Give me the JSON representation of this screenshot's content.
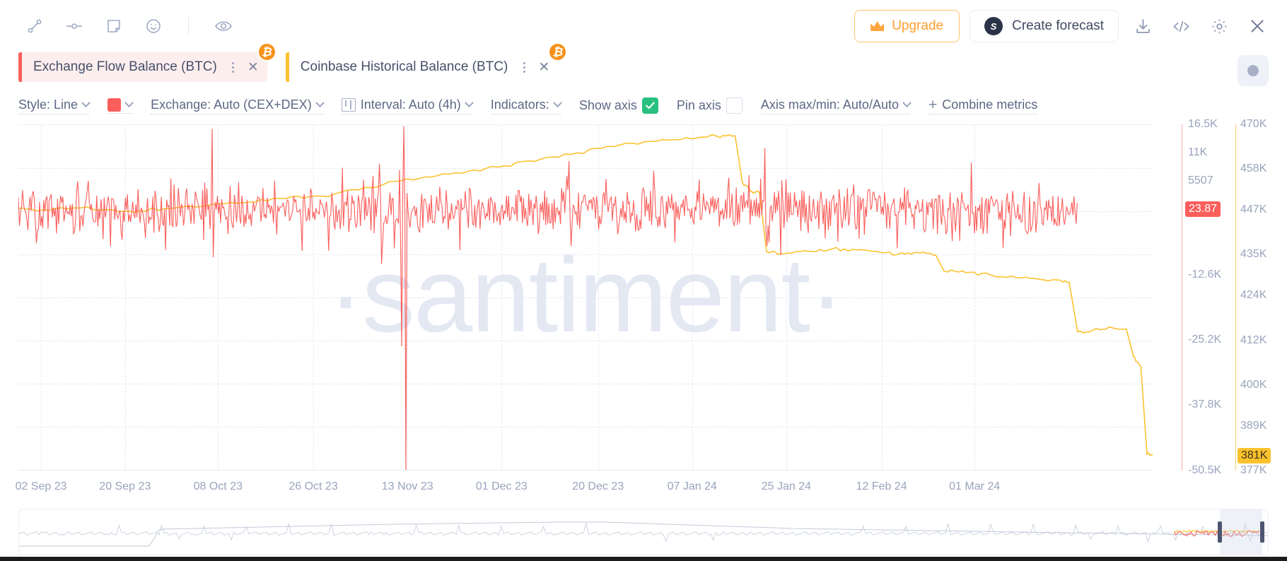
{
  "toolbar": {
    "tools": [
      {
        "name": "line-segment-icon",
        "title": "Draw line"
      },
      {
        "name": "horizontal-line-icon",
        "title": "Horizontal line"
      },
      {
        "name": "note-icon",
        "title": "Add note"
      },
      {
        "name": "emoji-icon",
        "title": "Add emoji"
      },
      {
        "name": "eye-icon",
        "title": "Toggle visibility"
      }
    ],
    "upgrade_label": "Upgrade",
    "forecast_label": "Create forecast",
    "s_logo_text": "S",
    "download_title": "Download",
    "embed_title": "Embed code",
    "settings_title": "Settings",
    "close_title": "Close"
  },
  "tabs": [
    {
      "label": "Exchange Flow Balance (BTC)",
      "accent_color": "#fb5e5b",
      "active": true,
      "asset_badge": "₿"
    },
    {
      "label": "Coinbase Historical Balance (BTC)",
      "accent_color": "#fbc22e",
      "active": false,
      "asset_badge": "₿"
    }
  ],
  "record_button": "record-toggle",
  "settings": {
    "style_label": "Style: Line",
    "color_value": "#fb5e5b",
    "exchange_label": "Exchange: Auto (CEX+DEX)",
    "interval_label": "Interval: Auto (4h)",
    "indicators_label": "Indicators:",
    "show_axis_label": "Show axis",
    "show_axis_checked": true,
    "pin_axis_label": "Pin axis",
    "pin_axis_checked": false,
    "axis_minmax_label": "Axis max/min: Auto/Auto",
    "combine_label": "Combine metrics",
    "combine_plus": "+"
  },
  "chart_data": {
    "type": "line",
    "title": "",
    "watermark": "·santiment·",
    "xlabel": "",
    "grid": true,
    "legend": "none",
    "x_tick_labels": [
      "02 Sep 23",
      "20 Sep 23",
      "08 Oct 23",
      "26 Oct 23",
      "13 Nov 23",
      "01 Dec 23",
      "20 Dec 23",
      "07 Jan 24",
      "25 Jan 24",
      "12 Feb 24",
      "01 Mar 24"
    ],
    "x_tick_positions_pct": [
      2.0,
      9.4,
      17.6,
      26.0,
      34.3,
      42.6,
      51.1,
      59.4,
      67.7,
      76.1,
      84.3
    ],
    "axes": [
      {
        "name": "Exchange Flow Balance (BTC)",
        "color": "#fb5e5b",
        "side": "right-inner",
        "ylim": [
          -50500,
          16500
        ],
        "tick_labels": [
          "16.5K",
          "11K",
          "5507",
          "23.87",
          "-12.6K",
          "-25.2K",
          "-37.8K",
          "-50.5K"
        ],
        "tick_values": [
          16500,
          11000,
          5507,
          23.87,
          -12600,
          -25200,
          -37800,
          -50500
        ],
        "highlighted_tick": "23.87",
        "highlight_color": "#fb5e5b"
      },
      {
        "name": "Coinbase Historical Balance (BTC)",
        "color": "#fbc22e",
        "side": "right-outer",
        "ylim": [
          377000,
          470000
        ],
        "tick_labels": [
          "470K",
          "458K",
          "447K",
          "435K",
          "424K",
          "412K",
          "400K",
          "389K",
          "381K",
          "377K"
        ],
        "tick_values": [
          470000,
          458000,
          447000,
          435000,
          424000,
          412000,
          400000,
          389000,
          381000,
          377000
        ],
        "highlighted_tick": "381K",
        "highlight_color": "#fbc22e"
      }
    ],
    "series": [
      {
        "name": "Exchange Flow Balance (BTC)",
        "color": "#fb5e5b",
        "axis": 0,
        "description": "High-frequency oscillating flow around 0 BTC with large negative spikes; notable downward spikes around 08 Oct 23, early Nov 23 and a very large one at ~11 Nov 23 reaching below -50K, plus positive spikes to ~11K.",
        "last_value": 23.87
      },
      {
        "name": "Coinbase Historical Balance (BTC)",
        "color": "#fbc22e",
        "axis": 1,
        "description": "Balance rises gradually from ~447K in Sep 23 to a peak of ~467K around 20 Dec 23, then steps down repeatedly: to ~440K in late Dec, ~435K in Jan, ~427K in early Feb, ~414K mid Feb, ~400K late Feb, ending at ~381K on 01 Mar 24.",
        "last_value": 381000
      }
    ]
  },
  "brush": {
    "name": "range-selector",
    "selected_range_pct": [
      92.0,
      99.0
    ]
  }
}
